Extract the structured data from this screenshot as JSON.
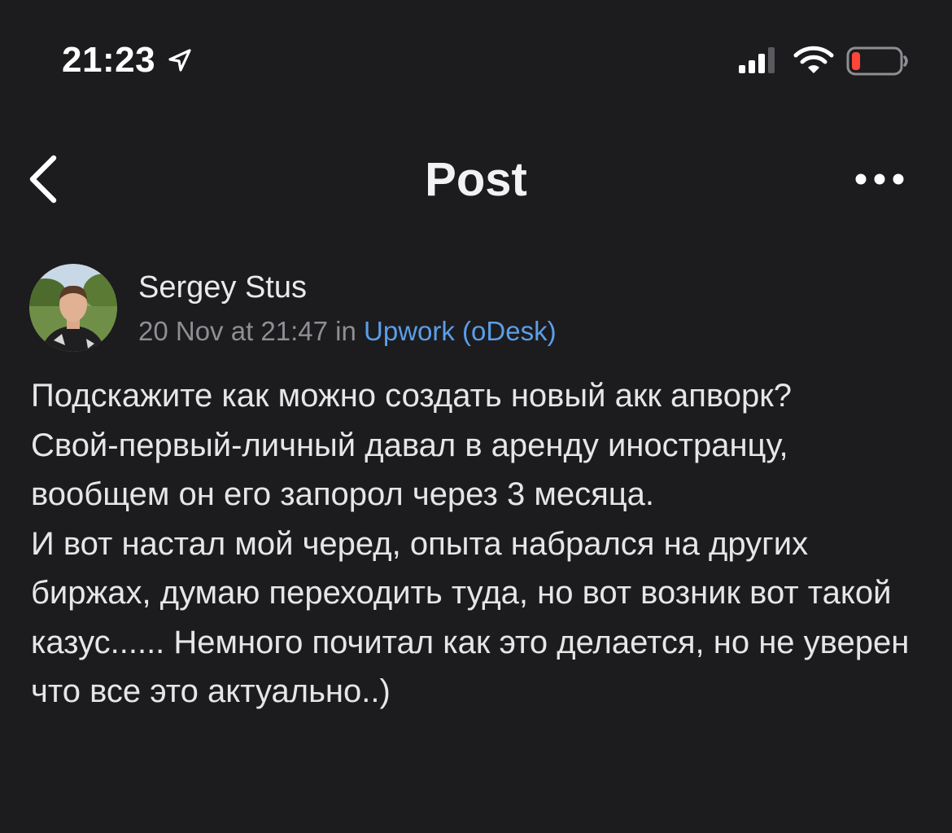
{
  "status_bar": {
    "time": "21:23",
    "icons": [
      "location-arrow-icon",
      "cellular-signal-icon",
      "wifi-icon",
      "battery-low-icon"
    ],
    "battery_color": "#ff453a"
  },
  "nav": {
    "title": "Post",
    "back_icon": "chevron-left-icon",
    "more_icon": "more-horizontal-icon"
  },
  "post": {
    "author": "Sergey Stus",
    "date": "20 Nov at 21:47",
    "in_word": "in",
    "community": "Upwork (oDesk)",
    "link_color": "#5b9ee8",
    "body": "Подскажите как можно создать новый акк апворк?\nСвой-первый-личный давал в аренду иностранцу, вообщем он его запорол через 3 месяца.\nИ вот настал мой черед, опыта набрался на других биржах, думаю переходить туда, но вот возник вот такой казус...... Немного почитал как это делается, но не уверен что все это актуально..)"
  },
  "theme": {
    "background": "#1c1c1e",
    "text": "#e6e6e6",
    "secondary_text": "#8e8e93"
  }
}
